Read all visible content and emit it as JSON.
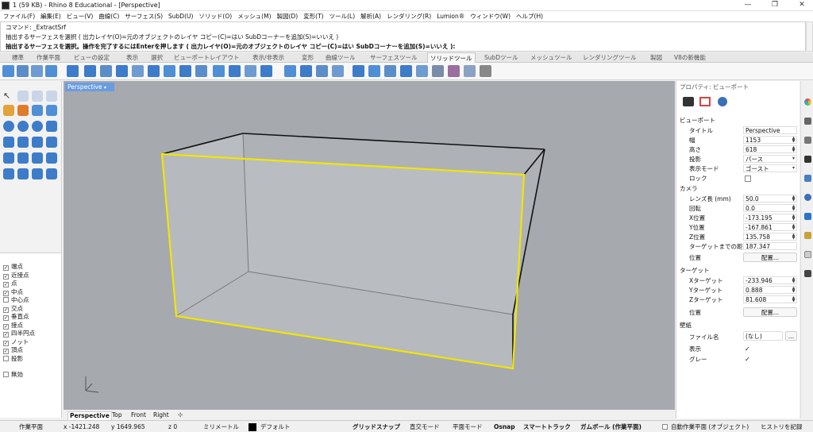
{
  "window": {
    "title": "1 (59 KB) - Rhino 8 Educational - [Perspective]"
  },
  "menu": [
    "ファイル(F)",
    "編集(E)",
    "ビュー(V)",
    "曲線(C)",
    "サーフェス(S)",
    "SubD(U)",
    "ソリッド(O)",
    "メッシュ(M)",
    "製図(D)",
    "変形(T)",
    "ツール(L)",
    "解析(A)",
    "レンダリング(R)",
    "Lumion®",
    "ウィンドウ(W)",
    "ヘルプ(H)"
  ],
  "command": {
    "line1": "コマンド: _ExtractSrf",
    "line2": "抽出するサーフェスを選択 ( 出力レイヤ(O)=元のオブジェクトのレイヤ  コピー(C)=はい  SubDコーナーを追加(S)=いいえ )",
    "line3": "抽出するサーフェスを選択。操作を完了するにはEnterを押します ( 出力レイヤ(O)=元のオブジェクトのレイヤ  コピー(C)=はい  SubDコーナーを追加(S)=いいえ ):"
  },
  "tabs": [
    "標準",
    "作業平面",
    "ビューの設定",
    "表示",
    "選択",
    "ビューポートレイアウト",
    "表示/非表示",
    "変形",
    "曲線ツール",
    "サーフェスツール",
    "ソリッドツール",
    "SubDツール",
    "メッシュツール",
    "レンダリングツール",
    "製図",
    "V8の新機能"
  ],
  "active_tab": "ソリッドツール",
  "osnaps": [
    {
      "label": "端点",
      "checked": true
    },
    {
      "label": "近接点",
      "checked": true
    },
    {
      "label": "点",
      "checked": true
    },
    {
      "label": "中点",
      "checked": true
    },
    {
      "label": "中心点",
      "checked": false
    },
    {
      "label": "交点",
      "checked": true
    },
    {
      "label": "垂直点",
      "checked": true
    },
    {
      "label": "接点",
      "checked": true
    },
    {
      "label": "四半円点",
      "checked": true
    },
    {
      "label": "ノット",
      "checked": true
    },
    {
      "label": "頂点",
      "checked": true
    },
    {
      "label": "投影",
      "checked": false
    },
    {
      "label": "無効",
      "checked": false
    }
  ],
  "viewport": {
    "name": "Perspective"
  },
  "view_tabs": [
    "Perspective",
    "Top",
    "Front",
    "Right"
  ],
  "props": {
    "header": "プロパティ: ビューポート",
    "sec_viewport": "ビューポート",
    "title_label": "タイトル",
    "title_value": "Perspective",
    "width_label": "幅",
    "width_value": "1153",
    "height_label": "高さ",
    "height_value": "618",
    "proj_label": "投影",
    "proj_value": "パース",
    "mode_label": "表示モード",
    "mode_value": "ゴースト",
    "lock_label": "ロック",
    "sec_camera": "カメラ",
    "lens_label": "レンズ長 (mm)",
    "lens_value": "50.0",
    "rot_label": "回転",
    "rot_value": "0.0",
    "x_label": "X位置",
    "x_value": "-173.195",
    "y_label": "Y位置",
    "y_value": "-167.861",
    "z_label": "Z位置",
    "z_value": "135.758",
    "dist_label": "ターゲットまでの距",
    "dist_value": "187.347",
    "pos_label": "位置",
    "place_btn": "配置...",
    "sec_target": "ターゲット",
    "tx_label": "Xターゲット",
    "tx_value": "-233.946",
    "ty_label": "Yターゲット",
    "ty_value": "0.888",
    "tz_label": "Zターゲット",
    "tz_value": "81.608",
    "tpos_label": "位置",
    "tplace_btn": "配置...",
    "sec_wall": "壁紙",
    "file_label": "ファイル名",
    "file_value": "(なし)",
    "browse": "...",
    "show_label": "表示",
    "gray_label": "グレー"
  },
  "status": {
    "cplane": "作業平面",
    "x": "x -1421.248",
    "y": "y 1649.965",
    "z": "z 0",
    "units": "ミリメートル",
    "layer": "デフォルト",
    "grid": "グリッドスナップ",
    "ortho": "直交モード",
    "planar": "平面モード",
    "osnap": "Osnap",
    "smarttrack": "スマートトラック",
    "gumball": "ガムボール (作業平面)",
    "autocplane": "自動作業平面 (オブジェクト)",
    "history": "ヒストリを記録"
  }
}
